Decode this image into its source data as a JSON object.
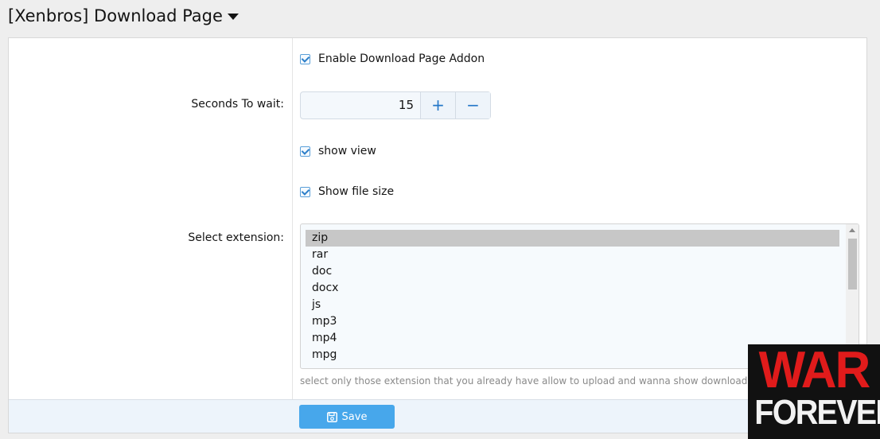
{
  "header": {
    "title": "[Xenbros] Download Page"
  },
  "form": {
    "enable_addon": {
      "label": "Enable Download Page Addon",
      "checked": true
    },
    "seconds": {
      "label": "Seconds To wait:",
      "value": "15",
      "plus": "+",
      "minus": "−"
    },
    "show_view": {
      "label": "show view",
      "checked": true
    },
    "show_file_size": {
      "label": "Show file size",
      "checked": true
    },
    "extension": {
      "label": "Select extension:",
      "options": [
        "zip",
        "rar",
        "doc",
        "docx",
        "js",
        "mp3",
        "mp4",
        "mpg"
      ],
      "selected": "zip",
      "hint": "select only those extension that you already have allow to upload and wanna show download page"
    },
    "save_label": "Save"
  },
  "watermark": {
    "line1": "WAR",
    "line2": "FOREVER"
  },
  "colors": {
    "accent": "#47a7eb",
    "checkbox": "#2d7fc9",
    "footer": "#edf4fb"
  }
}
